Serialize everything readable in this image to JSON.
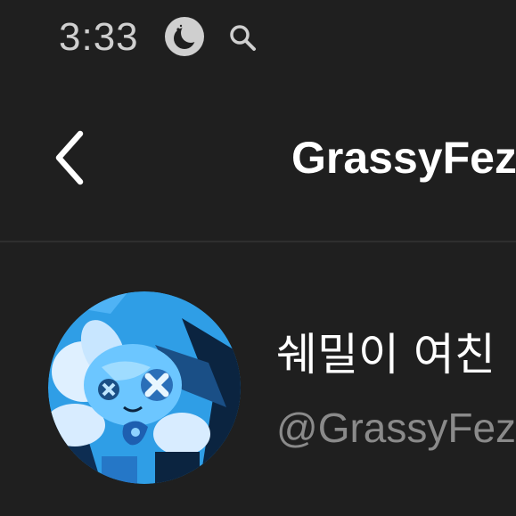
{
  "status_bar": {
    "time": "3:33",
    "icons": [
      "moon-icon",
      "search-icon"
    ]
  },
  "header": {
    "title": "GrassyFez",
    "back_icon": "chevron-left-icon"
  },
  "profile": {
    "display_name": "쉐밀이 여친",
    "handle": "@GrassyFez"
  },
  "colors": {
    "background": "#1f1f1f",
    "text_primary": "#ffffff",
    "text_secondary": "#8a8a8a",
    "divider": "#2e2e2e"
  }
}
